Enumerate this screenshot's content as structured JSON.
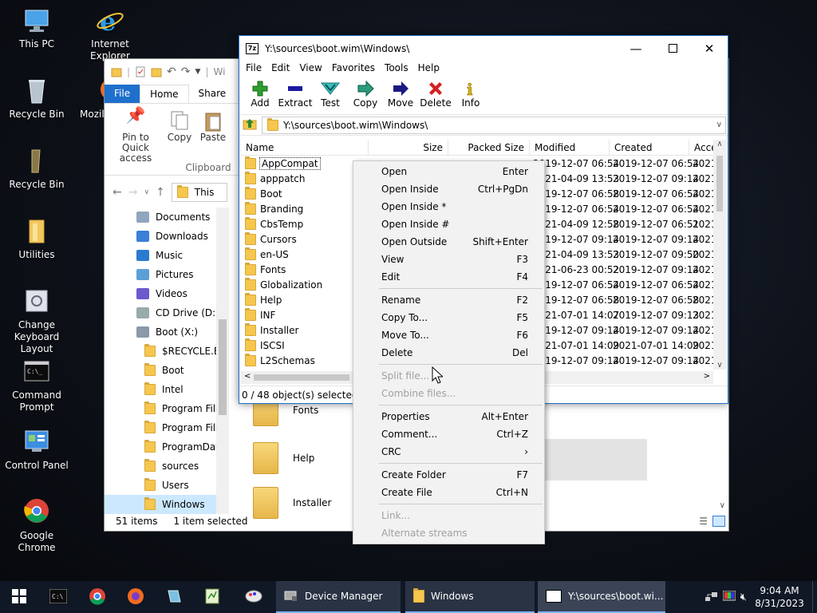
{
  "desktop": {
    "icons": [
      {
        "label": "This PC",
        "icon": "this-pc-icon"
      },
      {
        "label": "Internet Explorer",
        "icon": "internet-explorer-icon"
      },
      {
        "label": "Recycle Bin",
        "icon": "recycle-bin-icon"
      },
      {
        "label": "Mozil",
        "icon": "firefox-icon"
      },
      {
        "label": "Recycle Bin",
        "icon": "recycle-bin-icon"
      },
      {
        "label": "Utilities",
        "icon": "folder-icon"
      },
      {
        "label": "Change Keyboard Layout",
        "icon": "keyboard-icon"
      },
      {
        "label": "Command Prompt",
        "icon": "cmd-icon"
      },
      {
        "label": "Control Panel",
        "icon": "control-panel-icon"
      },
      {
        "label": "Google Chrome",
        "icon": "chrome-icon"
      }
    ]
  },
  "explorer": {
    "title_partial": "Wi",
    "tabs": {
      "file": "File",
      "home": "Home",
      "share": "Share"
    },
    "ribbon": {
      "pin": "Pin to Quick access",
      "copy": "Copy",
      "paste": "Paste",
      "group": "Clipboard"
    },
    "address_partial": "This",
    "nav": [
      {
        "label": "Documents",
        "icon": "documents-icon"
      },
      {
        "label": "Downloads",
        "icon": "downloads-icon"
      },
      {
        "label": "Music",
        "icon": "music-icon"
      },
      {
        "label": "Pictures",
        "icon": "pictures-icon"
      },
      {
        "label": "Videos",
        "icon": "videos-icon"
      },
      {
        "label": "CD Drive (D:) v",
        "icon": "cd-drive-icon"
      },
      {
        "label": "Boot (X:)",
        "icon": "drive-icon"
      },
      {
        "label": "$RECYCLE.BIN",
        "icon": "folder-icon"
      },
      {
        "label": "Boot",
        "icon": "folder-icon"
      },
      {
        "label": "Intel",
        "icon": "folder-icon"
      },
      {
        "label": "Program Files",
        "icon": "folder-icon"
      },
      {
        "label": "Program Files",
        "icon": "folder-icon"
      },
      {
        "label": "ProgramData",
        "icon": "folder-icon"
      },
      {
        "label": "sources",
        "icon": "folder-icon"
      },
      {
        "label": "Users",
        "icon": "folder-icon"
      },
      {
        "label": "Windows",
        "icon": "folder-icon"
      }
    ],
    "big_items": [
      "Fonts",
      "Help",
      "Installer"
    ],
    "status": {
      "count": "51 items",
      "selected": "1 item selected"
    }
  },
  "zip": {
    "title": "Y:\\sources\\boot.wim\\Windows\\",
    "menu": [
      "File",
      "Edit",
      "View",
      "Favorites",
      "Tools",
      "Help"
    ],
    "toolbar": [
      {
        "label": "Add",
        "icon": "add-icon",
        "color": "#2e9e2e"
      },
      {
        "label": "Extract",
        "icon": "extract-icon",
        "color": "#1a1aa0"
      },
      {
        "label": "Test",
        "icon": "test-icon",
        "color": "#1aa0a0"
      },
      {
        "label": "Copy",
        "icon": "copy-arrow-icon",
        "color": "#1a8a6a"
      },
      {
        "label": "Move",
        "icon": "move-arrow-icon",
        "color": "#1a1a80"
      },
      {
        "label": "Delete",
        "icon": "delete-icon",
        "color": "#d42020"
      },
      {
        "label": "Info",
        "icon": "info-icon",
        "color": "#c8a800"
      }
    ],
    "path": "Y:\\sources\\boot.wim\\Windows\\",
    "columns": [
      "Name",
      "Size",
      "Packed Size",
      "Modified",
      "Created",
      "Acce"
    ],
    "rows": [
      {
        "name": "AppCompat",
        "modified": "2019-12-07 06:54",
        "created": "2019-12-07 06:54",
        "accessed": "2021-"
      },
      {
        "name": "apppatch",
        "modified": "2021-04-09 13:53",
        "created": "2019-12-07 09:14",
        "accessed": "2021-"
      },
      {
        "name": "Boot",
        "modified": "2019-12-07 06:58",
        "created": "2019-12-07 06:54",
        "accessed": "2021-"
      },
      {
        "name": "Branding",
        "modified": "2019-12-07 06:54",
        "created": "2019-12-07 06:54",
        "accessed": "2021-"
      },
      {
        "name": "CbsTemp",
        "modified": "2021-04-09 12:58",
        "created": "2019-12-07 06:51",
        "accessed": "2021-"
      },
      {
        "name": "Cursors",
        "modified": "2019-12-07 09:14",
        "created": "2019-12-07 09:14",
        "accessed": "2021-"
      },
      {
        "name": "en-US",
        "modified": "2021-04-09 13:53",
        "created": "2019-12-07 09:50",
        "accessed": "2021-"
      },
      {
        "name": "Fonts",
        "modified": "2021-06-23 00:52",
        "created": "2019-12-07 09:14",
        "accessed": "2021-"
      },
      {
        "name": "Globalization",
        "modified": "2019-12-07 06:54",
        "created": "2019-12-07 06:54",
        "accessed": "2021-"
      },
      {
        "name": "Help",
        "modified": "2019-12-07 06:58",
        "created": "2019-12-07 06:58",
        "accessed": "2021-"
      },
      {
        "name": "INF",
        "modified": "2021-07-01 14:07",
        "created": "2019-12-07 09:13",
        "accessed": "2021-"
      },
      {
        "name": "Installer",
        "modified": "2019-12-07 09:14",
        "created": "2019-12-07 09:14",
        "accessed": "2021-"
      },
      {
        "name": "ISCSI",
        "modified": "2021-07-01 14:09",
        "created": "2021-07-01 14:09",
        "accessed": "2021-"
      },
      {
        "name": "L2Schemas",
        "modified": "2019-12-07 09:14",
        "created": "2019-12-07 09:14",
        "accessed": "2021-"
      }
    ],
    "status": "0 / 48 object(s) selected"
  },
  "context_menu": [
    {
      "label": "Open",
      "key": "Enter",
      "enabled": true
    },
    {
      "label": "Open Inside",
      "key": "Ctrl+PgDn",
      "enabled": true
    },
    {
      "label": "Open Inside *",
      "key": "",
      "enabled": true
    },
    {
      "label": "Open Inside #",
      "key": "",
      "enabled": true
    },
    {
      "label": "Open Outside",
      "key": "Shift+Enter",
      "enabled": true
    },
    {
      "label": "View",
      "key": "F3",
      "enabled": true
    },
    {
      "label": "Edit",
      "key": "F4",
      "enabled": true
    },
    {
      "sep": true
    },
    {
      "label": "Rename",
      "key": "F2",
      "enabled": true
    },
    {
      "label": "Copy To...",
      "key": "F5",
      "enabled": true
    },
    {
      "label": "Move To...",
      "key": "F6",
      "enabled": true
    },
    {
      "label": "Delete",
      "key": "Del",
      "enabled": true
    },
    {
      "sep": true
    },
    {
      "label": "Split file...",
      "key": "",
      "enabled": false
    },
    {
      "label": "Combine files...",
      "key": "",
      "enabled": false
    },
    {
      "sep": true
    },
    {
      "label": "Properties",
      "key": "Alt+Enter",
      "enabled": true
    },
    {
      "label": "Comment...",
      "key": "Ctrl+Z",
      "enabled": true
    },
    {
      "label": "CRC",
      "key": "›",
      "enabled": true
    },
    {
      "sep": true
    },
    {
      "label": "Create Folder",
      "key": "F7",
      "enabled": true
    },
    {
      "label": "Create File",
      "key": "Ctrl+N",
      "enabled": true
    },
    {
      "sep": true
    },
    {
      "label": "Link...",
      "key": "",
      "enabled": false
    },
    {
      "label": "Alternate streams",
      "key": "",
      "enabled": false
    }
  ],
  "taskbar": {
    "tasks": [
      {
        "label": "Device Manager",
        "icon": "device-manager-icon"
      },
      {
        "label": "Windows",
        "icon": "folder-icon"
      },
      {
        "label": "Y:\\sources\\boot.wi...",
        "icon": "7zip-icon"
      }
    ],
    "time": "9:04 AM",
    "date": "8/31/2023"
  },
  "colors": {
    "accent": "#1f6fcc",
    "folder": "#f6c74e",
    "taskbar": "#101725"
  }
}
